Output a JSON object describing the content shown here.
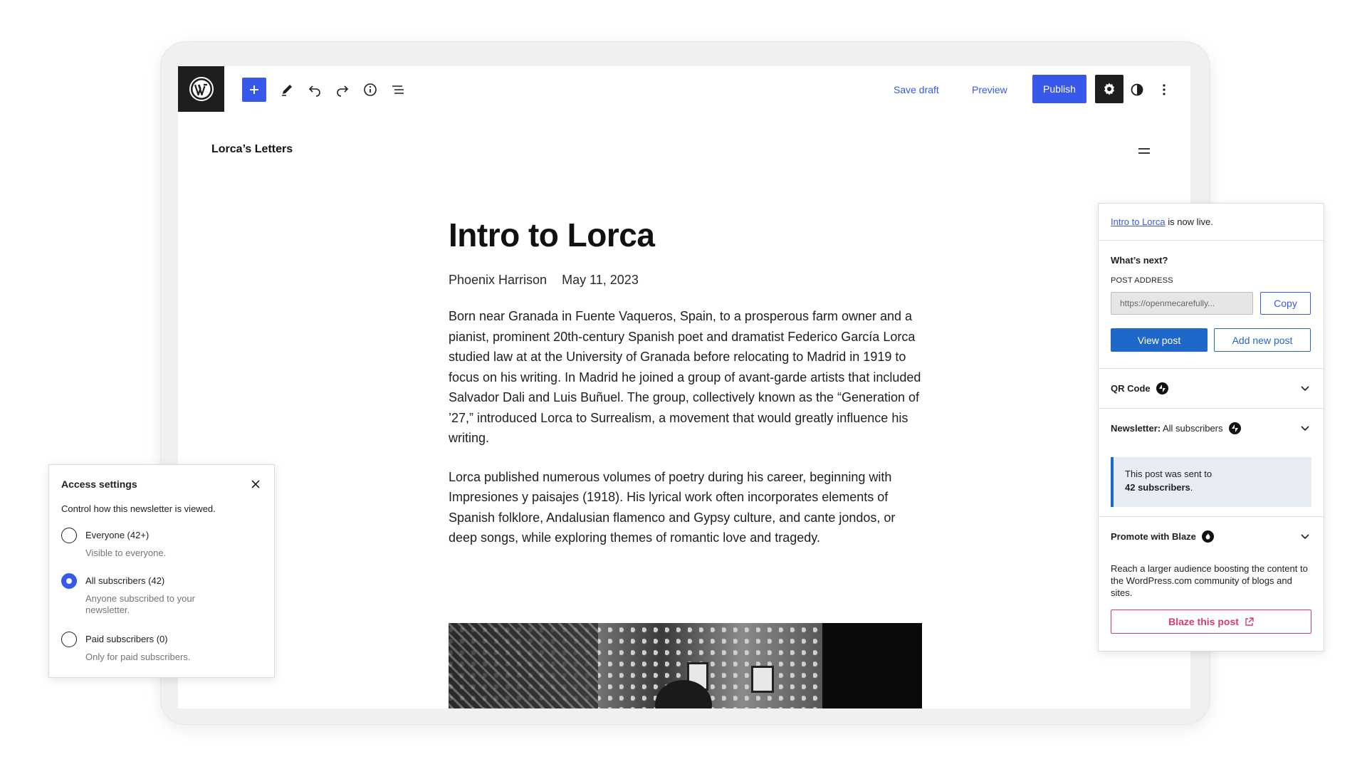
{
  "toolbar": {
    "save_draft": "Save draft",
    "preview": "Preview",
    "publish": "Publish",
    "icons": [
      "wordpress-logo",
      "plus-icon",
      "pencil-icon",
      "undo-icon",
      "redo-icon",
      "info-icon",
      "list-view-icon",
      "gear-icon",
      "contrast-icon",
      "more-vertical-icon"
    ]
  },
  "site": {
    "title": "Lorca’s Letters"
  },
  "post": {
    "title": "Intro to Lorca",
    "author": "Phoenix Harrison",
    "date": "May 11, 2023",
    "paragraph_1": "Born near Granada in Fuente Vaqueros, Spain, to a prosperous farm owner and a pianist, prominent 20th-century Spanish poet and dramatist Federico García Lorca studied law at at the University of Granada before relocating to Madrid in 1919 to focus on his writing. In Madrid he joined a group of avant-garde artists that included Salvador Dali and Luis Buñuel. The group, collectively known as the “Generation of ’27,” introduced Lorca to Surrealism, a movement that would greatly influence his writing.",
    "paragraph_2": "Lorca published numerous volumes of poetry during his career, beginning with Impresiones y paisajes (1918). His lyrical work often incorporates elements of Spanish folklore, Andalusian flamenco and Gypsy culture, and cante jondos, or deep songs, while exploring themes of romantic love and tragedy."
  },
  "access": {
    "title": "Access settings",
    "description": "Control how this newsletter is viewed.",
    "options": [
      {
        "label": "Everyone (42+)",
        "help": "Visible to everyone.",
        "checked": false
      },
      {
        "label": "All subscribers (42)",
        "help": "Anyone subscribed to your newsletter.",
        "checked": true
      },
      {
        "label": "Paid subscribers (0)",
        "help": "Only for paid subscribers.",
        "checked": false
      }
    ]
  },
  "panel": {
    "live_link": "Intro to Lorca",
    "live_suffix": " is now live.",
    "whats_next": "What’s next?",
    "post_address_label": "POST ADDRESS",
    "post_address_value": "https://openmecarefully...",
    "copy": "Copy",
    "view_post": "View post",
    "add_new_post": "Add new post",
    "qr_code": "QR Code",
    "newsletter_label": "Newsletter:",
    "newsletter_value": " All subscribers",
    "notice_line1": "This post was sent to",
    "notice_count": "42 subscribers",
    "notice_end": ".",
    "promote_title": "Promote with Blaze",
    "promote_desc": "Reach a larger audience boosting the content to the WordPress.com community of blogs and sites.",
    "blaze_button": "Blaze this post"
  },
  "colors": {
    "accent": "#3858e9",
    "link_blue": "#1e68c9",
    "blaze": "#d63d6a",
    "dark": "#1e1e1e"
  }
}
